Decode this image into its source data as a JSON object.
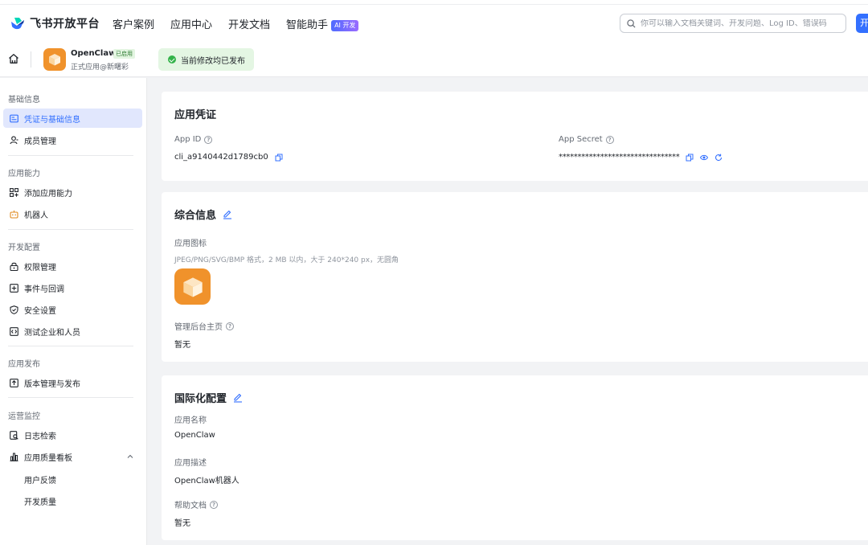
{
  "topbar": {
    "brand": "飞书开放平台",
    "nav": [
      "客户案例",
      "应用中心",
      "开发文档",
      "智能助手"
    ],
    "ai_badge": "AI 开发",
    "search_placeholder": "你可以输入文档关键词、开发问题、Log ID、错误码",
    "cta_label": "开"
  },
  "appbar": {
    "app_name": "OpenClaw",
    "app_status": "已启用",
    "app_subtitle": "正式应用@新曙彩",
    "publish_status": "当前修改均已发布"
  },
  "sidebar": {
    "groups": [
      {
        "title": "基础信息",
        "items": [
          "凭证与基础信息",
          "成员管理"
        ]
      },
      {
        "title": "应用能力",
        "items": [
          "添加应用能力",
          "机器人"
        ]
      },
      {
        "title": "开发配置",
        "items": [
          "权限管理",
          "事件与回调",
          "安全设置",
          "测试企业和人员"
        ]
      },
      {
        "title": "应用发布",
        "items": [
          "版本管理与发布"
        ]
      },
      {
        "title": "运营监控",
        "items": [
          "日志检索",
          "应用质量看板"
        ]
      }
    ],
    "sub_items": [
      "用户反馈",
      "开发质量"
    ]
  },
  "credentials": {
    "title": "应用凭证",
    "app_id_label": "App ID",
    "app_id_value": "cli_a9140442d1789cb0",
    "app_secret_label": "App Secret",
    "app_secret_value": "********************************"
  },
  "general": {
    "title": "综合信息",
    "icon_label": "应用图标",
    "icon_hint": "JPEG/PNG/SVG/BMP 格式，2 MB 以内，大于 240*240 px，无圆角",
    "homepage_label": "管理后台主页",
    "homepage_value": "暂无"
  },
  "i18n": {
    "title": "国际化配置",
    "name_label": "应用名称",
    "name_value": "OpenClaw",
    "desc_label": "应用描述",
    "desc_value": "OpenClaw机器人",
    "help_label": "帮助文档",
    "help_value": "暂无"
  },
  "colors": {
    "accent": "#3370ff",
    "app_icon": "#f0922b",
    "success": "#34b34a"
  }
}
